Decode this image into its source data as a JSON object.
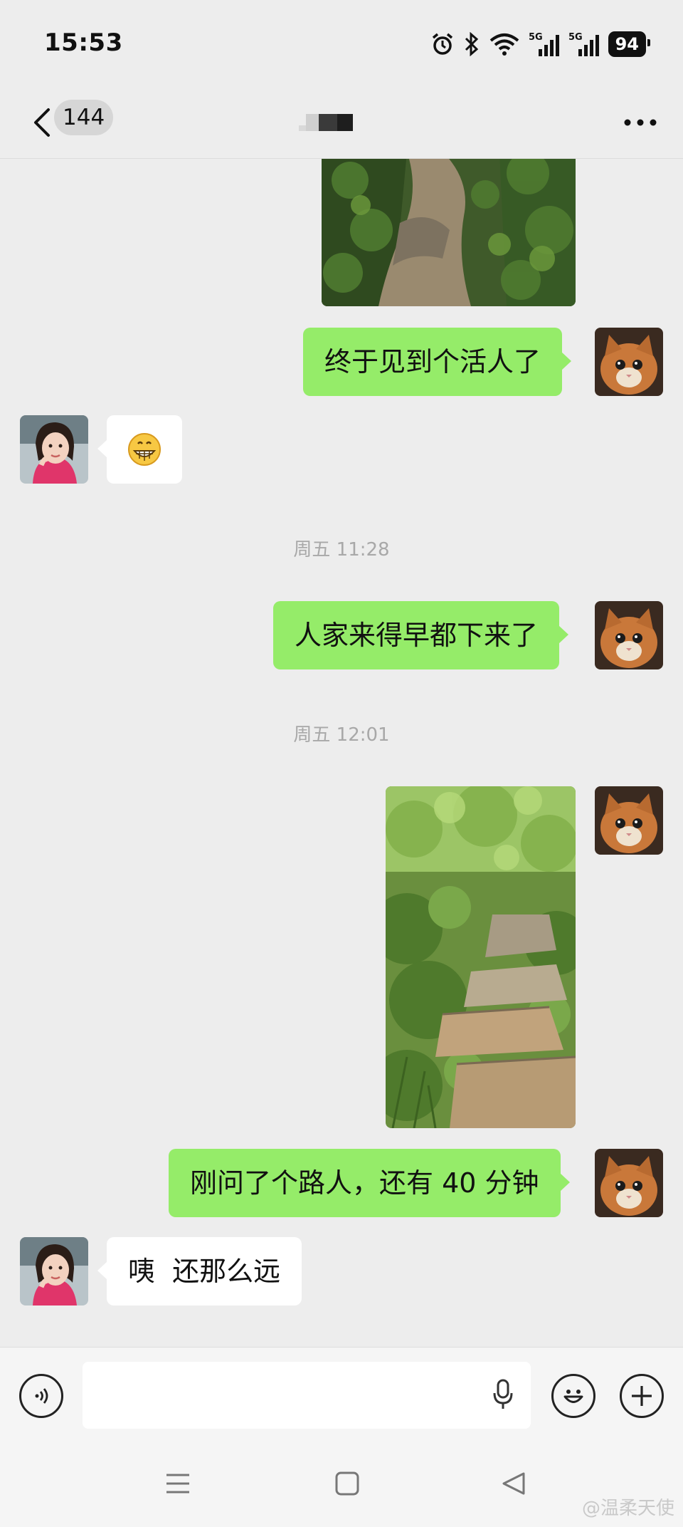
{
  "status_bar": {
    "time": "15:53",
    "battery": "94",
    "icons": [
      "alarm-icon",
      "bluetooth-icon",
      "wifi-icon",
      "signal-5g-icon",
      "signal-5g-icon"
    ]
  },
  "header": {
    "unread_count": "144",
    "back_icon": "chevron-left-icon",
    "more_icon": "more-dots-icon"
  },
  "messages": {
    "m1": {
      "sender": "me",
      "type": "image",
      "content": "path-through-greenery photo"
    },
    "m2": {
      "sender": "me",
      "type": "text",
      "text": "终于见到个活人了"
    },
    "m3": {
      "sender": "them",
      "type": "emoji",
      "text": "😁"
    },
    "ts1": {
      "type": "timestamp",
      "text": "周五 11:28"
    },
    "m4": {
      "sender": "me",
      "type": "text",
      "text": "人家来得早都下来了"
    },
    "ts2": {
      "type": "timestamp",
      "text": "周五 12:01"
    },
    "m5": {
      "sender": "me",
      "type": "image",
      "content": "rocky mountain trail photo"
    },
    "m6": {
      "sender": "me",
      "type": "text",
      "text": "刚问了个路人，还有 40 分钟"
    },
    "m7": {
      "sender": "them",
      "type": "text",
      "text": "咦  还那么远"
    }
  },
  "input_bar": {
    "voice_icon": "voice-mode-icon",
    "mic_icon": "microphone-icon",
    "emoji_icon": "emoji-icon",
    "plus_icon": "plus-icon",
    "placeholder": ""
  },
  "system_nav": {
    "icons": [
      "menu-icon",
      "home-icon",
      "back-triangle-icon"
    ],
    "watermark": "@温柔天使"
  },
  "colors": {
    "background": "#ededed",
    "my_bubble": "#95ec69",
    "their_bubble": "#ffffff",
    "timestamp_text": "#a8a8a8"
  }
}
